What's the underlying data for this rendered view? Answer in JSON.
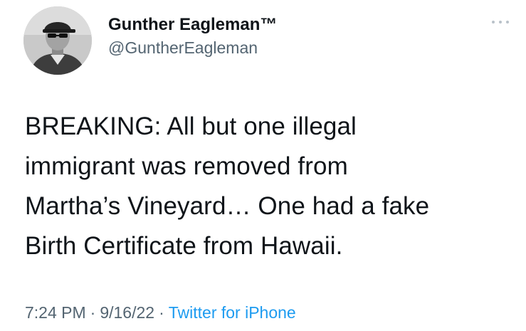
{
  "author": {
    "display_name": "Gunther Eagleman™",
    "handle": "@GuntherEagleman",
    "avatar": "profile-photo"
  },
  "tweet": {
    "lines": [
      "BREAKING: All but one illegal",
      "immigrant was removed from",
      "Martha’s Vineyard…  One had a fake",
      "Birth Certificate from Hawaii."
    ],
    "time": "7:24 PM",
    "date": "9/16/22",
    "source": "Twitter for iPhone",
    "separator": "·"
  },
  "icons": {
    "more": "more-options-icon"
  },
  "colors": {
    "text": "#0f1419",
    "secondary": "#536471",
    "link": "#1d9bf0"
  }
}
